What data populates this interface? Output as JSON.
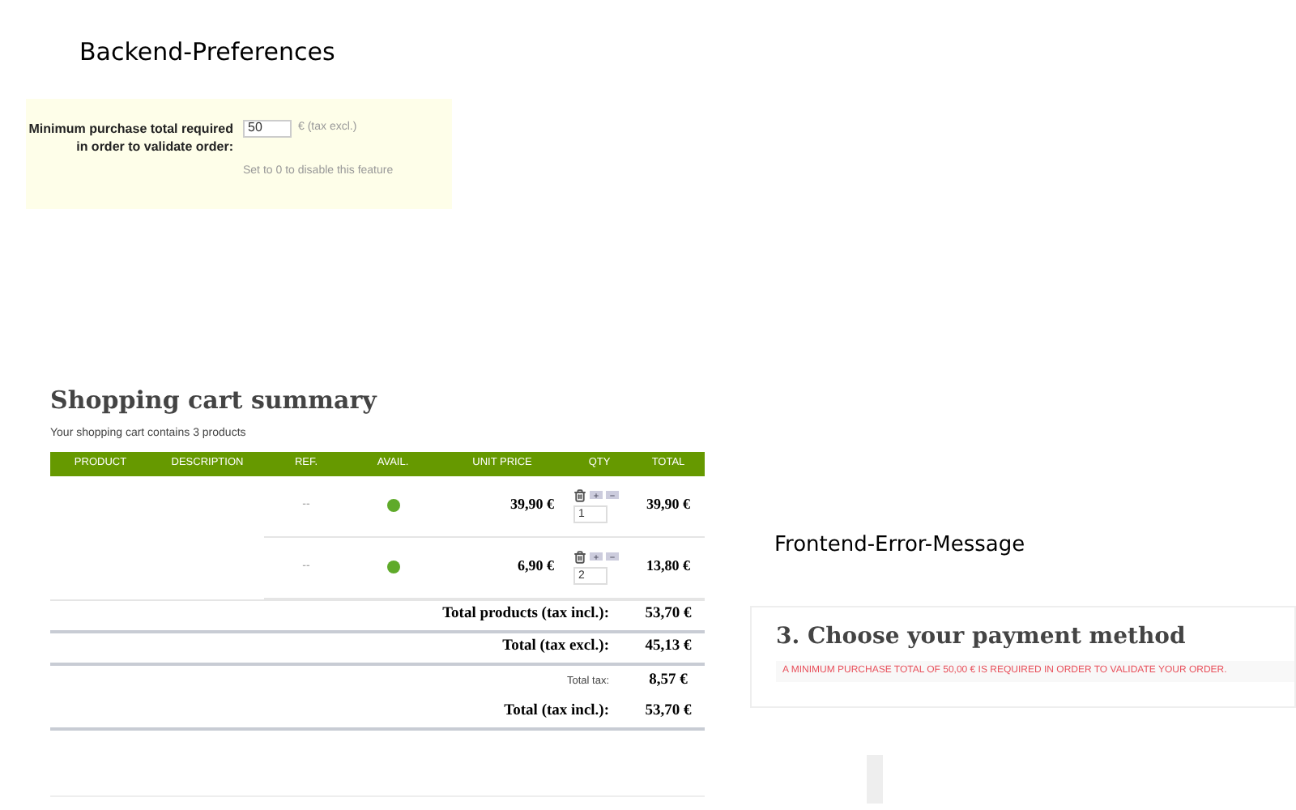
{
  "backend": {
    "title": "Backend-Preferences",
    "setting": {
      "label": "Minimum purchase total required in order to validate order:",
      "value": "50",
      "unit": "€ (tax excl.)",
      "hint": "Set to 0 to disable this feature"
    }
  },
  "cart": {
    "title": "Shopping cart summary",
    "summary": "Your shopping cart contains 3 products",
    "columns": [
      "PRODUCT",
      "DESCRIPTION",
      "REF.",
      "AVAIL.",
      "UNIT PRICE",
      "QTY",
      "TOTAL"
    ],
    "rows": [
      {
        "reference": "--",
        "available": true,
        "unit_price": "39,90 €",
        "quantity": "1",
        "total": "39,90 €"
      },
      {
        "reference": "--",
        "available": true,
        "unit_price": "6,90 €",
        "quantity": "2",
        "total": "13,80 €"
      }
    ],
    "totals": [
      {
        "kind": "major",
        "label": "Total products (tax incl.):",
        "value": "53,70 €"
      },
      {
        "kind": "major",
        "label": "Total (tax excl.):",
        "value": "45,13 €"
      },
      {
        "kind": "minor",
        "label": "Total tax:",
        "value": "8,57 €"
      },
      {
        "kind": "major",
        "label": "Total (tax incl.):",
        "value": "53,70 €"
      }
    ]
  },
  "frontend": {
    "title": "Frontend-Error-Message",
    "heading": "3. Choose your payment method",
    "error": "A MINIMUM PURCHASE TOTAL OF 50,00 € IS REQUIRED IN ORDER TO VALIDATE YOUR ORDER."
  }
}
